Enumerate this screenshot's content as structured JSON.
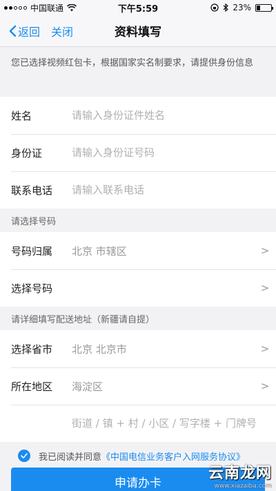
{
  "status_bar": {
    "carrier": "中国联通",
    "time": "下午5:59",
    "battery": "23%",
    "battery_level": 0.23
  },
  "nav": {
    "back_label": "返回",
    "close_label": "关闭",
    "title": "资料填写"
  },
  "notice": "您已选择视频红包卡，根据国家实名制要求，请提供身份信息",
  "identity": {
    "name_label": "姓名",
    "name_placeholder": "请输入身份证件姓名",
    "id_label": "身份证",
    "id_placeholder": "请输入身份证号码",
    "phone_label": "联系电话",
    "phone_placeholder": "请输入联系电话"
  },
  "number_section": {
    "header": "请选择号码",
    "location_label": "号码归属",
    "location_value": "北京 市辖区",
    "select_label": "选择号码",
    "chevron": ">"
  },
  "address_section": {
    "header": "请详细填写配送地址（新疆请自提）",
    "province_label": "选择省市",
    "province_value": "北京 北京市",
    "district_label": "所在地区",
    "district_value": "海淀区",
    "street_placeholder": "街道 / 镇 + 村 / 小区 / 写字楼 + 门牌号",
    "chevron": ">"
  },
  "agreement": {
    "prefix": "我已阅读并同意",
    "link": "《中国电信业务客户入网服务协议》"
  },
  "submit_label": "申请办卡",
  "watermark": {
    "main": "云南龙网",
    "sub": "www.xiazaiba.com"
  },
  "colors": {
    "accent": "#1a8cf0"
  }
}
